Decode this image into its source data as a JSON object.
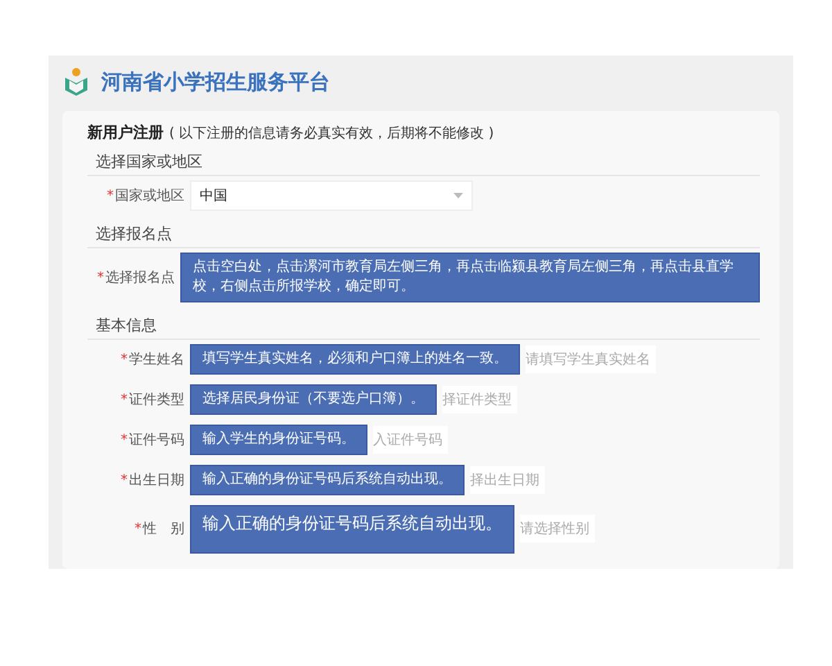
{
  "header": {
    "title": "河南省小学招生服务平台"
  },
  "form": {
    "title": "新用户注册",
    "note": "( 以下注册的信息请务必真实有效，后期将不能修改 )",
    "sections": [
      {
        "heading": "选择国家或地区",
        "fields": [
          {
            "kind": "select",
            "required_mark": "*",
            "label": "国家或地区",
            "value": "中国"
          }
        ]
      },
      {
        "heading": "选择报名点",
        "fields": [
          {
            "kind": "callout",
            "required_mark": "*",
            "label": "选择报名点",
            "callout": "点击空白处，点击漯河市教育局左侧三角，再点击临颍县教育局左侧三角，再点击县直学校，右侧点击所报学校，确定即可。"
          }
        ]
      },
      {
        "heading": "基本信息",
        "fields": [
          {
            "kind": "callout",
            "required_mark": "*",
            "label": "学生姓名",
            "callout": "填写学生真实姓名，必须和户口簿上的姓名一致。",
            "placeholder": "请填写学生真实姓名"
          },
          {
            "kind": "callout",
            "required_mark": "*",
            "label": "证件类型",
            "callout": "选择居民身份证（不要选户口簿）。",
            "placeholder": "择证件类型"
          },
          {
            "kind": "callout",
            "required_mark": "*",
            "label": "证件号码",
            "callout": "输入学生的身份证号码。",
            "placeholder": "入证件号码"
          },
          {
            "kind": "callout",
            "required_mark": "*",
            "label": "出生日期",
            "callout": "输入正确的身份证号码后系统自动出现。",
            "placeholder": "择出生日期"
          },
          {
            "kind": "callout",
            "required_mark": "*",
            "label": "性　别",
            "callout": "输入正确的身份证号码后系统自动出现。",
            "placeholder": "请选择性别"
          }
        ]
      }
    ]
  }
}
